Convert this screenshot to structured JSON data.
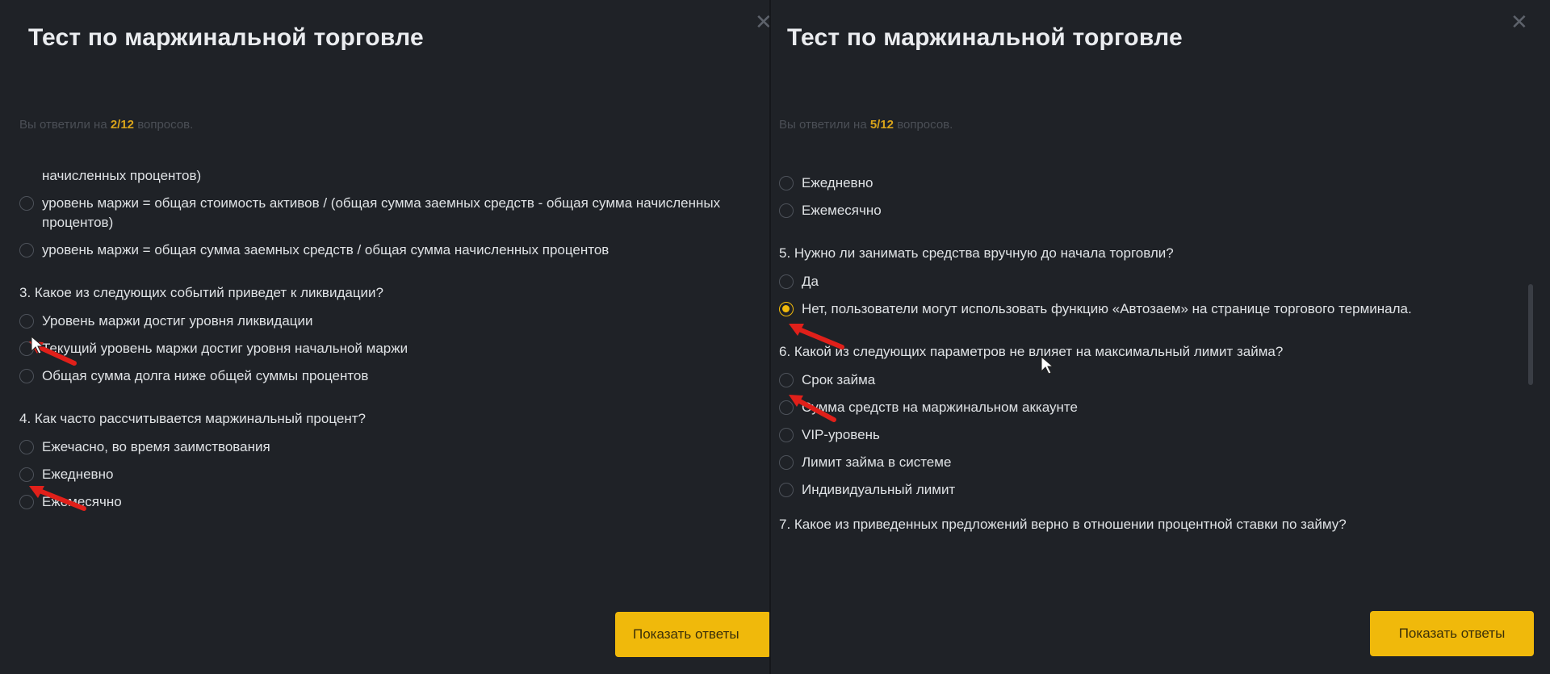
{
  "left": {
    "title": "Тест по маржинальной торговле",
    "close_symbol": "✕",
    "progress": {
      "prefix": "Вы ответили на ",
      "count": "2/12",
      "suffix": " вопросов."
    },
    "cut_top_text": "начисленных процентов)",
    "options_top": [
      {
        "text": "уровень маржи = общая стоимость активов / (общая сумма заемных средств - общая сумма начисленных процентов)",
        "selected": false
      },
      {
        "text": "уровень маржи = общая сумма заемных средств / общая сумма начисленных процентов",
        "selected": false
      }
    ],
    "q3": {
      "text": "3. Какое из следующих событий приведет к ликвидации?",
      "options": [
        {
          "text": "Уровень маржи достиг уровня ликвидации",
          "selected": false
        },
        {
          "text": "Текущий уровень маржи достиг уровня начальной маржи",
          "selected": false
        },
        {
          "text": "Общая сумма долга ниже общей суммы процентов",
          "selected": false
        }
      ]
    },
    "q4": {
      "text": "4. Как часто рассчитывается маржинальный процент?",
      "options": [
        {
          "text": "Ежечасно, во время заимствования",
          "selected": false
        },
        {
          "text": "Ежедневно",
          "selected": false
        },
        {
          "text": "Ежемесячно",
          "selected": false
        }
      ]
    },
    "show_answers_label": "Показать ответы"
  },
  "right": {
    "title": "Тест по маржинальной торговле",
    "close_symbol": "✕",
    "progress": {
      "prefix": "Вы ответили на ",
      "count": "5/12",
      "suffix": " вопросов."
    },
    "options_top": [
      {
        "text": "Ежедневно",
        "selected": false
      },
      {
        "text": "Ежемесячно",
        "selected": false
      }
    ],
    "q5": {
      "text": "5. Нужно ли занимать средства вручную до начала торговли?",
      "options": [
        {
          "text": "Да",
          "selected": false
        },
        {
          "text": "Нет, пользователи могут использовать функцию «Автозаем» на странице торгового терминала.",
          "selected": true
        }
      ]
    },
    "q6": {
      "text": "6. Какой из следующих параметров не влияет на максимальный лимит займа?",
      "options": [
        {
          "text": "Срок займа",
          "selected": false
        },
        {
          "text": "Сумма средств на маржинальном аккаунте",
          "selected": false
        },
        {
          "text": "VIP-уровень",
          "selected": false
        },
        {
          "text": "Лимит займа в системе",
          "selected": false
        },
        {
          "text": "Индивидуальный лимит",
          "selected": false
        }
      ]
    },
    "q7_cut_text": "7. Какое из приведенных предложений верно в отношении процентной ставки по займу?",
    "show_answers_label": "Показать ответы"
  },
  "colors": {
    "accent": "#f0b90b",
    "background": "#1f2227",
    "annotation_arrow": "#e0201a"
  }
}
